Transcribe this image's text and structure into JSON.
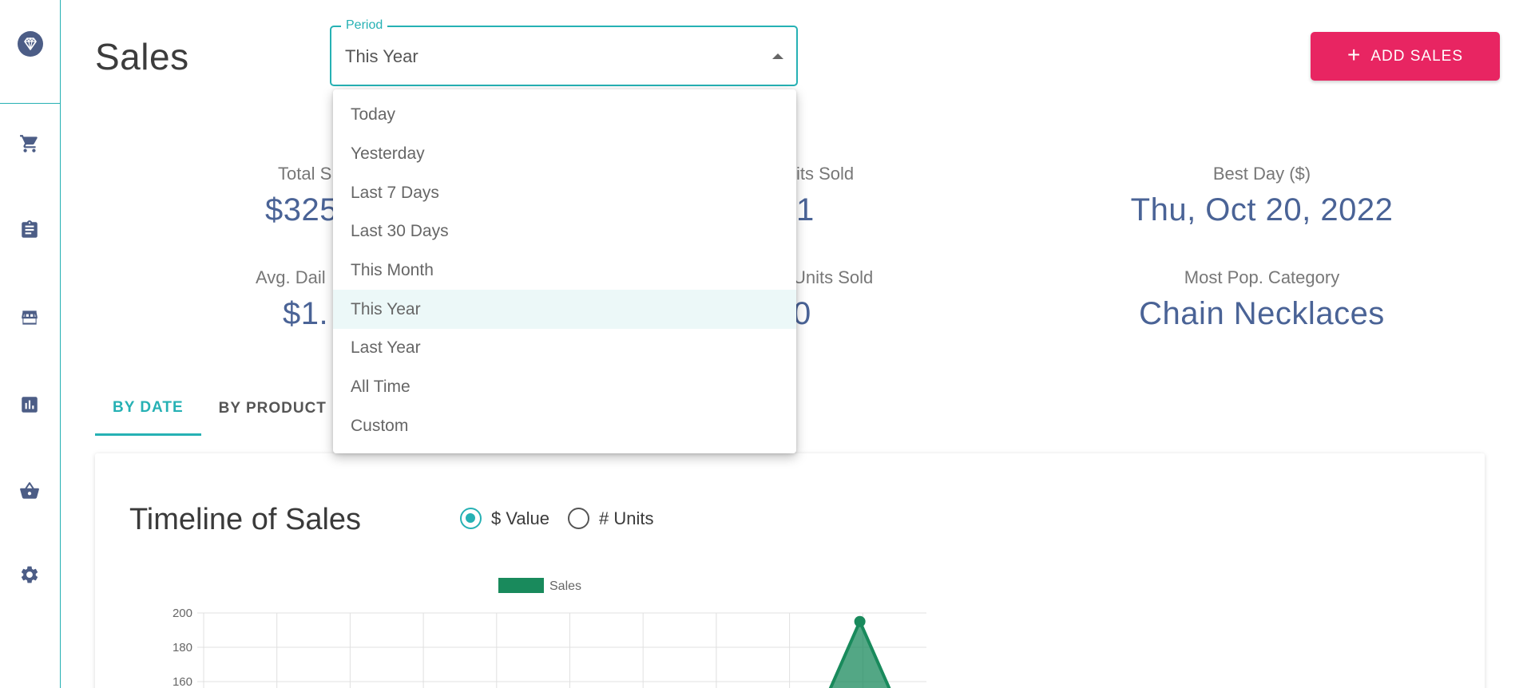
{
  "header": {
    "title": "Sales",
    "add_button_label": "ADD SALES"
  },
  "period": {
    "legend": "Period",
    "value": "This Year"
  },
  "menu": {
    "options": [
      "Today",
      "Yesterday",
      "Last 7 Days",
      "Last 30 Days",
      "This Month",
      "This Year",
      "Last Year",
      "All Time",
      "Custom"
    ],
    "selected_index": 5
  },
  "stats": {
    "total_sales": {
      "label": "Total S",
      "value": "$325"
    },
    "units_sold": {
      "label": "its Sold",
      "value": "1"
    },
    "best_day": {
      "label": "Best Day ($)",
      "value": "Thu, Oct 20, 2022"
    },
    "avg_daily": {
      "label": "Avg. Dail",
      "value": "$1."
    },
    "avg_units": {
      "label": "Units Sold",
      "value": "0"
    },
    "most_pop": {
      "label": "Most Pop. Category",
      "value": "Chain Necklaces"
    }
  },
  "tabs": {
    "by_date": "BY DATE",
    "by_product": "BY PRODUCT"
  },
  "card": {
    "title": "Timeline of Sales",
    "radio_value": "$ Value",
    "radio_units": "# Units"
  },
  "icons": [
    "diamond-icon",
    "cart-icon",
    "clipboard-icon",
    "store-icon",
    "bar-chart-icon",
    "basket-icon",
    "gear-icon"
  ],
  "colors": {
    "accent": "#26b1b4",
    "primary_button": "#e82562",
    "stat_value": "#4a6396",
    "sidebar_icon": "#4c5d86",
    "series": "#198a5c"
  },
  "chart_data": {
    "type": "line",
    "legend": [
      "Sales"
    ],
    "series": [
      {
        "name": "Sales",
        "peak_value": 195
      }
    ],
    "y_ticks": [
      200,
      180,
      160
    ],
    "ylim": [
      160,
      200
    ],
    "gridlines": true,
    "legend_position": "top"
  }
}
